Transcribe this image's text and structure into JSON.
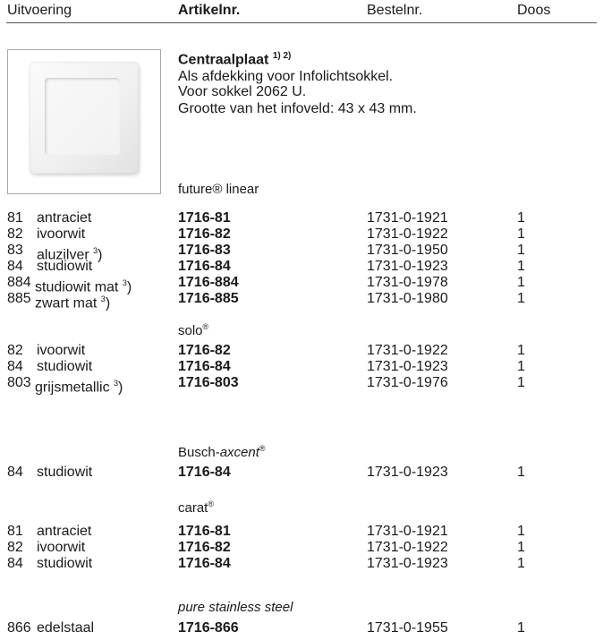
{
  "header": {
    "uitvoering": "Uitvoering",
    "artikelnr": "Artikelnr.",
    "bestelnr": "Bestelnr.",
    "doos": "Doos"
  },
  "product": {
    "title": "Centraalplaat",
    "title_notes": "1) 2)",
    "desc_1": "Als afdekking voor Infolichtsokkel.",
    "desc_2": "Voor sokkel 2062 U.",
    "desc_3": "Grootte van het infoveld: 43 x 43 mm."
  },
  "sections": [
    {
      "name": "future",
      "suffix": "® linear",
      "rows": [
        {
          "code": "81",
          "name": "antraciet",
          "note": "",
          "art": "1716-81",
          "best": "1731-0-1921",
          "doos": "1"
        },
        {
          "code": "82",
          "name": "ivoorwit",
          "note": "",
          "art": "1716-82",
          "best": "1731-0-1922",
          "doos": "1"
        },
        {
          "code": "83",
          "name": "aluzilver",
          "note": "3",
          "art": "1716-83",
          "best": "1731-0-1950",
          "doos": "1"
        },
        {
          "code": "84",
          "name": "studiowit",
          "note": "",
          "art": "1716-84",
          "best": "1731-0-1923",
          "doos": "1"
        },
        {
          "code": "884",
          "name": "studiowit mat",
          "note": "3",
          "art": "1716-884",
          "best": "1731-0-1978",
          "doos": "1"
        },
        {
          "code": "885",
          "name": "zwart mat",
          "note": "3",
          "art": "1716-885",
          "best": "1731-0-1980",
          "doos": "1"
        }
      ]
    },
    {
      "name": "solo",
      "suffix": "®",
      "rows": [
        {
          "code": "82",
          "name": "ivoorwit",
          "note": "",
          "art": "1716-82",
          "best": "1731-0-1922",
          "doos": "1"
        },
        {
          "code": "84",
          "name": "studiowit",
          "note": "",
          "art": "1716-84",
          "best": "1731-0-1923",
          "doos": "1"
        },
        {
          "code": "803",
          "name": "grijsmetallic",
          "note": "3",
          "art": "1716-803",
          "best": "1731-0-1976",
          "doos": "1"
        }
      ]
    },
    {
      "name": "Busch-",
      "italic": "axcent",
      "suffix": "®",
      "rows": [
        {
          "code": "84",
          "name": "studiowit",
          "note": "",
          "art": "1716-84",
          "best": "1731-0-1923",
          "doos": "1"
        }
      ]
    },
    {
      "name": "carat",
      "suffix": "®",
      "rows": [
        {
          "code": "81",
          "name": "antraciet",
          "note": "",
          "art": "1716-81",
          "best": "1731-0-1921",
          "doos": "1"
        },
        {
          "code": "82",
          "name": "ivoorwit",
          "note": "",
          "art": "1716-82",
          "best": "1731-0-1922",
          "doos": "1"
        },
        {
          "code": "84",
          "name": "studiowit",
          "note": "",
          "art": "1716-84",
          "best": "1731-0-1923",
          "doos": "1"
        }
      ]
    },
    {
      "italic": "pure stainless steel",
      "rows": [
        {
          "code": "866",
          "name": "edelstaal",
          "note": "",
          "art": "1716-866",
          "best": "1731-0-1955",
          "doos": "1"
        }
      ]
    }
  ]
}
